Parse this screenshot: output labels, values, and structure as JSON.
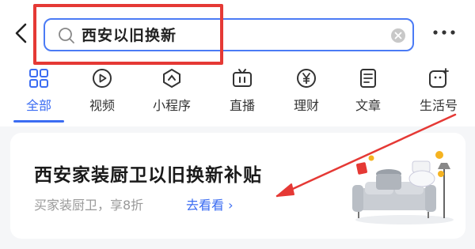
{
  "search": {
    "query": "西安以旧换新"
  },
  "tabs": [
    {
      "label": "全部",
      "icon": "grid-icon",
      "active": true
    },
    {
      "label": "视频",
      "icon": "video-play-icon"
    },
    {
      "label": "小程序",
      "icon": "mini-program-icon"
    },
    {
      "label": "直播",
      "icon": "live-tv-icon"
    },
    {
      "label": "理财",
      "icon": "yen-icon"
    },
    {
      "label": "文章",
      "icon": "article-icon"
    },
    {
      "label": "生活号",
      "icon": "life-account-icon"
    }
  ],
  "card": {
    "title": "西安家装厨卫以旧换新补贴",
    "subtitle": "买家装厨卫，享8折",
    "link": "去看看 ›",
    "illustration": "home-appliances-illustration"
  },
  "annotation": {
    "color": "#e53935"
  },
  "colors": {
    "accent": "#3b6cf2",
    "background": "#f5f6f8"
  }
}
